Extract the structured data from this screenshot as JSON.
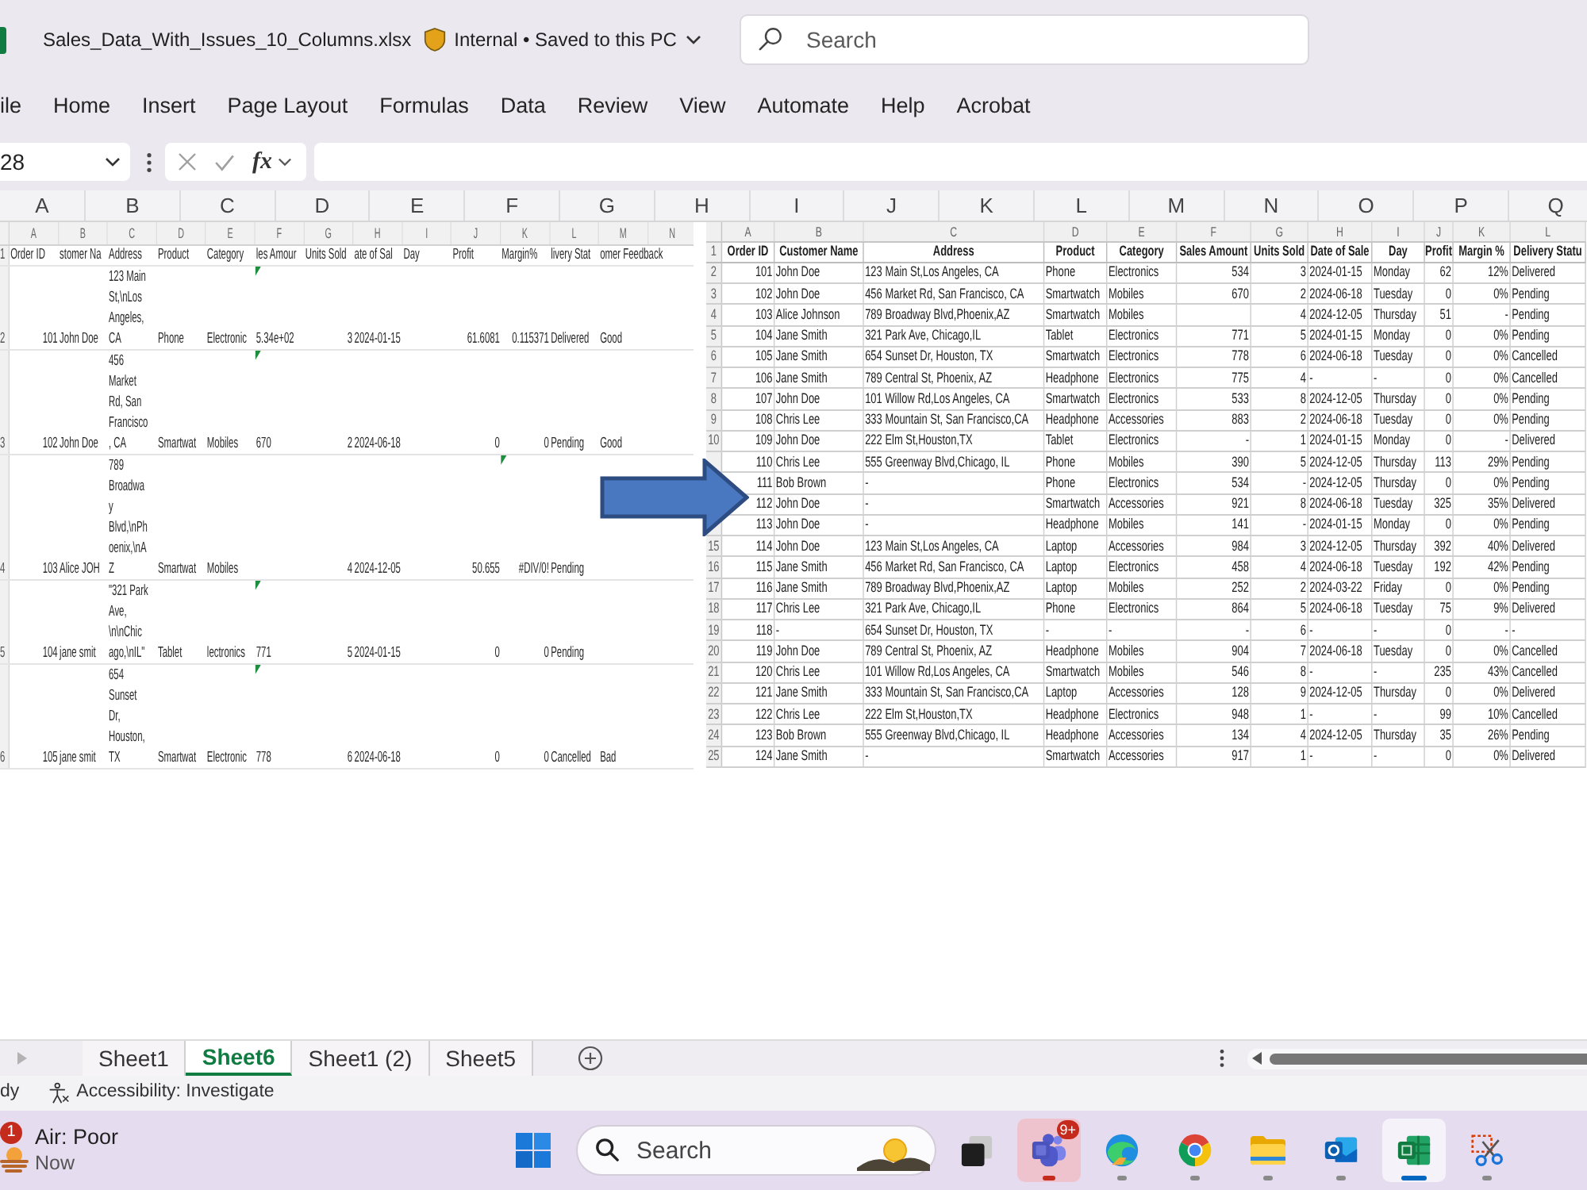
{
  "window": {
    "title": "Sales_Data_With_Issues_10_Columns.xlsx",
    "status": "Internal • Saved to this PC"
  },
  "search": {
    "placeholder": "Search"
  },
  "ribbon_tabs": [
    "ile",
    "Home",
    "Insert",
    "Page Layout",
    "Formulas",
    "Data",
    "Review",
    "View",
    "Automate",
    "Help",
    "Acrobat"
  ],
  "formula_bar": {
    "name_box": "28",
    "function_button": "fx"
  },
  "sheet": {
    "column_headers": [
      "A",
      "B",
      "C",
      "D",
      "E",
      "F",
      "G",
      "H",
      "I",
      "J",
      "K",
      "L",
      "M",
      "N",
      "O",
      "P",
      "Q"
    ]
  },
  "pictures": [
    {
      "kind": "wrapped-sheet",
      "column_letters": [
        "A",
        "B",
        "C",
        "D",
        "E",
        "F",
        "G",
        "H",
        "I",
        "J",
        "K",
        "L",
        "M",
        "N"
      ],
      "header": {
        "row_number": "1",
        "cells": [
          "Order ID",
          "stomer Na",
          "Address",
          "Product",
          "Category",
          "les Amour",
          "Units Sold",
          "ate of Sal",
          "Day",
          "Profit",
          "Margin%",
          "livery Stat",
          "omer Feedback"
        ]
      },
      "rows": [
        {
          "row_number": "2",
          "cells": [
            "101",
            "John Doe",
            [
              "123 Main",
              "St,\\nLos",
              "Angeles,",
              "CA"
            ],
            "Phone",
            "Electronic",
            "5.34e+02",
            "3",
            "2024-01-15",
            null,
            "61.6081",
            "0.115371",
            "Delivered",
            "Good"
          ],
          "sales_flag": true,
          "margin_flag": false
        },
        {
          "row_number": "3",
          "cells": [
            "102",
            "John Doe",
            [
              "456",
              "Market",
              "Rd, San",
              "Francisco",
              ", CA"
            ],
            "Smartwat",
            "Mobiles",
            "670",
            "2",
            "2024-06-18",
            null,
            "0",
            "0",
            "Pending",
            "Good"
          ],
          "sales_flag": true,
          "margin_flag": false
        },
        {
          "row_number": "4",
          "cells": [
            "103",
            "Alice JOH",
            [
              "789",
              "Broadwa",
              "y",
              "Blvd,\\nPh",
              "oenix,\\nA",
              "Z"
            ],
            "Smartwat",
            "Mobiles",
            null,
            "4",
            "2024-12-05",
            null,
            "50.655",
            "#DIV/0!",
            "Pending",
            null
          ],
          "sales_flag": false,
          "margin_flag": true
        },
        {
          "row_number": "5",
          "cells": [
            "104",
            "jane smit",
            [
              "\"321 Park",
              "Ave,",
              "\\n\\nChic",
              "ago,\\nIL\""
            ],
            "Tablet",
            "lectronics",
            "771",
            "5",
            "2024-01-15",
            null,
            "0",
            "0",
            "Pending",
            null
          ],
          "sales_flag": true,
          "margin_flag": false
        },
        {
          "row_number": "6",
          "cells": [
            "105",
            "jane smit",
            [
              "654",
              "Sunset",
              "Dr,",
              "Houston,",
              "TX"
            ],
            "Smartwat",
            "Electronic",
            "778",
            "6",
            "2024-06-18",
            null,
            "0",
            "0",
            "Cancelled",
            "Bad"
          ],
          "sales_flag": true,
          "margin_flag": false
        }
      ]
    },
    {
      "kind": "bordered-sheet",
      "column_letters": [
        "A",
        "B",
        "C",
        "D",
        "E",
        "F",
        "G",
        "H",
        "I",
        "J",
        "K",
        "L"
      ],
      "header": {
        "row_number": "1",
        "cells": [
          "Order ID",
          "Customer Name",
          "Address",
          "Product",
          "Category",
          "Sales Amount",
          "Units Sold",
          "Date of Sale",
          "Day",
          "Profit",
          "Margin %",
          "Delivery Statu"
        ]
      },
      "rows": [
        {
          "row_number": "2",
          "cells": [
            "101",
            "John Doe",
            "123 Main St,Los Angeles, CA",
            "Phone",
            "Electronics",
            "534",
            "3",
            "2024-01-15",
            "Monday",
            "62",
            "12%",
            "Delivered"
          ]
        },
        {
          "row_number": "3",
          "cells": [
            "102",
            "John Doe",
            "456 Market Rd, San Francisco, CA",
            "Smartwatch",
            "Mobiles",
            "670",
            "2",
            "2024-06-18",
            "Tuesday",
            "0",
            "0%",
            "Pending"
          ]
        },
        {
          "row_number": "4",
          "cells": [
            "103",
            "Alice Johnson",
            "789 Broadway Blvd,Phoenix,AZ",
            "Smartwatch",
            "Mobiles",
            null,
            "4",
            "2024-12-05",
            "Thursday",
            "51",
            "-",
            "Pending"
          ]
        },
        {
          "row_number": "5",
          "cells": [
            "104",
            "Jane Smith",
            "321 Park Ave, Chicago,IL",
            "Tablet",
            "Electronics",
            "771",
            "5",
            "2024-01-15",
            "Monday",
            "0",
            "0%",
            "Pending"
          ]
        },
        {
          "row_number": "6",
          "cells": [
            "105",
            "Jane Smith",
            "654 Sunset Dr, Houston, TX",
            "Smartwatch",
            "Electronics",
            "778",
            "6",
            "2024-06-18",
            "Tuesday",
            "0",
            "0%",
            "Cancelled"
          ]
        },
        {
          "row_number": "7",
          "cells": [
            "106",
            "Jane Smith",
            "789 Central St, Phoenix, AZ",
            "Headphone",
            "Electronics",
            "775",
            "4",
            "-",
            "-",
            "0",
            "0%",
            "Cancelled"
          ]
        },
        {
          "row_number": "8",
          "cells": [
            "107",
            "John Doe",
            "101 Willow Rd,Los Angeles, CA",
            "Smartwatch",
            "Electronics",
            "533",
            "8",
            "2024-12-05",
            "Thursday",
            "0",
            "0%",
            "Pending"
          ]
        },
        {
          "row_number": "9",
          "cells": [
            "108",
            "Chris Lee",
            "333 Mountain St, San Francisco,CA",
            "Headphone",
            "Accessories",
            "883",
            "2",
            "2024-06-18",
            "Tuesday",
            "0",
            "0%",
            "Pending"
          ]
        },
        {
          "row_number": "10",
          "cells": [
            "109",
            "John Doe",
            "222 Elm St,Houston,TX",
            "Tablet",
            "Electronics",
            "-",
            "1",
            "2024-01-15",
            "Monday",
            "0",
            "-",
            "Delivered"
          ]
        },
        {
          "cells": [
            "110",
            "Chris Lee",
            "555 Greenway Blvd,Chicago, IL",
            "Phone",
            "Mobiles",
            "390",
            "5",
            "2024-12-05",
            "Thursday",
            "113",
            "29%",
            "Pending"
          ]
        },
        {
          "cells": [
            "111",
            "Bob Brown",
            "-",
            "Phone",
            "Electronics",
            "534",
            "-",
            "2024-12-05",
            "Thursday",
            "0",
            "0%",
            "Pending"
          ]
        },
        {
          "cells": [
            "112",
            "John Doe",
            "-",
            "Smartwatch",
            "Accessories",
            "921",
            "8",
            "2024-06-18",
            "Tuesday",
            "325",
            "35%",
            "Delivered"
          ]
        },
        {
          "cells": [
            "113",
            "John Doe",
            "-",
            "Headphone",
            "Mobiles",
            "141",
            "-",
            "2024-01-15",
            "Monday",
            "0",
            "0%",
            "Pending"
          ]
        },
        {
          "row_number": "15",
          "cells": [
            "114",
            "John Doe",
            "123 Main St,Los Angeles, CA",
            "Laptop",
            "Accessories",
            "984",
            "3",
            "2024-12-05",
            "Thursday",
            "392",
            "40%",
            "Delivered"
          ]
        },
        {
          "row_number": "16",
          "cells": [
            "115",
            "Jane Smith",
            "456 Market Rd, San Francisco, CA",
            "Laptop",
            "Electronics",
            "458",
            "4",
            "2024-06-18",
            "Tuesday",
            "192",
            "42%",
            "Pending"
          ]
        },
        {
          "row_number": "17",
          "cells": [
            "116",
            "Jane Smith",
            "789 Broadway Blvd,Phoenix,AZ",
            "Laptop",
            "Mobiles",
            "252",
            "2",
            "2024-03-22",
            "Friday",
            "0",
            "0%",
            "Pending"
          ]
        },
        {
          "row_number": "18",
          "cells": [
            "117",
            "Chris Lee",
            "321 Park Ave, Chicago,IL",
            "Phone",
            "Electronics",
            "864",
            "5",
            "2024-06-18",
            "Tuesday",
            "75",
            "9%",
            "Delivered"
          ]
        },
        {
          "row_number": "19",
          "cells": [
            "118",
            "-",
            "654 Sunset Dr, Houston, TX",
            "-",
            "-",
            "-",
            "6",
            "-",
            "-",
            "0",
            "-",
            "-"
          ]
        },
        {
          "row_number": "20",
          "cells": [
            "119",
            "John Doe",
            "789 Central St, Phoenix, AZ",
            "Headphone",
            "Mobiles",
            "904",
            "7",
            "2024-06-18",
            "Tuesday",
            "0",
            "0%",
            "Cancelled"
          ]
        },
        {
          "row_number": "21",
          "cells": [
            "120",
            "Chris Lee",
            "101 Willow Rd,Los Angeles, CA",
            "Smartwatch",
            "Mobiles",
            "546",
            "8",
            "-",
            "-",
            "235",
            "43%",
            "Cancelled"
          ]
        },
        {
          "row_number": "22",
          "cells": [
            "121",
            "Jane Smith",
            "333 Mountain St, San Francisco,CA",
            "Laptop",
            "Accessories",
            "128",
            "9",
            "2024-12-05",
            "Thursday",
            "0",
            "0%",
            "Delivered"
          ]
        },
        {
          "row_number": "23",
          "cells": [
            "122",
            "Chris Lee",
            "222 Elm St,Houston,TX",
            "Headphone",
            "Electronics",
            "948",
            "1",
            "-",
            "-",
            "99",
            "10%",
            "Cancelled"
          ]
        },
        {
          "row_number": "24",
          "cells": [
            "123",
            "Bob Brown",
            "555 Greenway Blvd,Chicago, IL",
            "Headphone",
            "Accessories",
            "134",
            "4",
            "2024-12-05",
            "Thursday",
            "35",
            "26%",
            "Pending"
          ]
        },
        {
          "row_number": "25",
          "cells": [
            "124",
            "Jane Smith",
            "-",
            "Smartwatch",
            "Accessories",
            "917",
            "1",
            "-",
            "-",
            "0",
            "0%",
            "Delivered"
          ]
        }
      ]
    }
  ],
  "sheet_tabs": [
    {
      "label": "Sheet1",
      "selected": false
    },
    {
      "label": "Sheet6",
      "selected": true
    },
    {
      "label": "Sheet1 (2)",
      "selected": false
    },
    {
      "label": "Sheet5",
      "selected": false
    }
  ],
  "status_bar": {
    "mode": "dy",
    "accessibility": "Accessibility: Investigate"
  },
  "taskbar": {
    "weather": {
      "badge": "1",
      "title": "Air: Poor",
      "subtitle": "Now"
    },
    "search": {
      "placeholder": "Search"
    },
    "apps": [
      {
        "kind": "task-view",
        "running": false,
        "active": false,
        "flashing": false
      },
      {
        "kind": "chat",
        "running": true,
        "active": false,
        "flashing": true,
        "badge": "9+"
      },
      {
        "kind": "swirl-browser",
        "running": true,
        "active": false,
        "flashing": false
      },
      {
        "kind": "ring-browser",
        "running": true,
        "active": false,
        "flashing": false
      },
      {
        "kind": "folder",
        "running": true,
        "active": false,
        "flashing": false
      },
      {
        "kind": "mail",
        "running": true,
        "active": false,
        "flashing": false
      },
      {
        "kind": "spreadsheet",
        "running": true,
        "active": true,
        "flashing": false
      },
      {
        "kind": "scissors",
        "running": true,
        "active": false,
        "flashing": false
      }
    ]
  }
}
